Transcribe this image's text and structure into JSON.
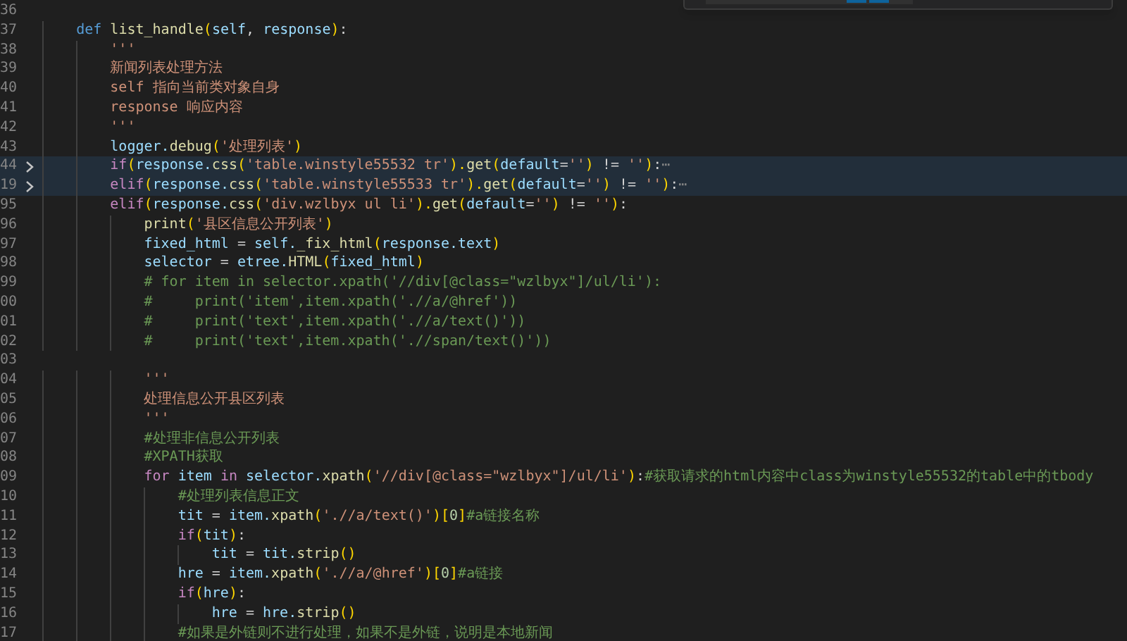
{
  "editor": {
    "lines": [
      {
        "number": "36",
        "folded": false
      },
      {
        "number": "37",
        "folded": false,
        "tokens": [
          {
            "kind": "keyword",
            "text": "    def "
          },
          {
            "kind": "function",
            "text": "list_handle"
          },
          {
            "kind": "bracket",
            "text": "("
          },
          {
            "kind": "variable",
            "text": "self"
          },
          {
            "kind": "plain",
            "text": ", "
          },
          {
            "kind": "variable",
            "text": "response"
          },
          {
            "kind": "bracket",
            "text": ")"
          },
          {
            "kind": "plain",
            "text": ":"
          }
        ]
      },
      {
        "number": "38",
        "folded": false,
        "tokens": [
          {
            "kind": "string",
            "text": "        '''"
          }
        ]
      },
      {
        "number": "39",
        "folded": false,
        "tokens": [
          {
            "kind": "string",
            "text": "        新闻列表处理方法"
          }
        ]
      },
      {
        "number": "40",
        "folded": false,
        "tokens": [
          {
            "kind": "string",
            "text": "        self 指向当前类对象自身"
          }
        ]
      },
      {
        "number": "41",
        "folded": false,
        "tokens": [
          {
            "kind": "string",
            "text": "        response 响应内容"
          }
        ]
      },
      {
        "number": "42",
        "folded": false,
        "tokens": [
          {
            "kind": "string",
            "text": "        '''"
          }
        ]
      },
      {
        "number": "43",
        "folded": false,
        "tokens": [
          {
            "kind": "variable",
            "text": "        logger."
          },
          {
            "kind": "function",
            "text": "debug"
          },
          {
            "kind": "bracket",
            "text": "("
          },
          {
            "kind": "string",
            "text": "'处理列表'"
          },
          {
            "kind": "bracket",
            "text": ")"
          }
        ]
      },
      {
        "number": "44",
        "folded": true,
        "tokens": [
          {
            "kind": "control",
            "text": "        if"
          },
          {
            "kind": "bracket",
            "text": "("
          },
          {
            "kind": "variable",
            "text": "response."
          },
          {
            "kind": "function",
            "text": "css"
          },
          {
            "kind": "bracket",
            "text": "("
          },
          {
            "kind": "string",
            "text": "'table.winstyle55532 tr'"
          },
          {
            "kind": "bracket",
            "text": ")."
          },
          {
            "kind": "function",
            "text": "get"
          },
          {
            "kind": "bracket",
            "text": "("
          },
          {
            "kind": "variable",
            "text": "default"
          },
          {
            "kind": "plain",
            "text": "="
          },
          {
            "kind": "string",
            "text": "''"
          },
          {
            "kind": "bracket",
            "text": ")"
          },
          {
            "kind": "plain",
            "text": " != "
          },
          {
            "kind": "string",
            "text": "''"
          },
          {
            "kind": "bracket",
            "text": ")"
          },
          {
            "kind": "plain",
            "text": ":"
          },
          {
            "kind": "fold",
            "text": "⋯"
          }
        ]
      },
      {
        "number": "19",
        "folded": true,
        "tokens": [
          {
            "kind": "control",
            "text": "        elif"
          },
          {
            "kind": "bracket",
            "text": "("
          },
          {
            "kind": "variable",
            "text": "response."
          },
          {
            "kind": "function",
            "text": "css"
          },
          {
            "kind": "bracket",
            "text": "("
          },
          {
            "kind": "string",
            "text": "'table.winstyle55533 tr'"
          },
          {
            "kind": "bracket",
            "text": ")."
          },
          {
            "kind": "function",
            "text": "get"
          },
          {
            "kind": "bracket",
            "text": "("
          },
          {
            "kind": "variable",
            "text": "default"
          },
          {
            "kind": "plain",
            "text": "="
          },
          {
            "kind": "string",
            "text": "''"
          },
          {
            "kind": "bracket",
            "text": ")"
          },
          {
            "kind": "plain",
            "text": " != "
          },
          {
            "kind": "string",
            "text": "''"
          },
          {
            "kind": "bracket",
            "text": ")"
          },
          {
            "kind": "plain",
            "text": ":"
          },
          {
            "kind": "fold",
            "text": "⋯"
          }
        ]
      },
      {
        "number": "95",
        "folded": false,
        "tokens": [
          {
            "kind": "control",
            "text": "        elif"
          },
          {
            "kind": "bracket",
            "text": "("
          },
          {
            "kind": "variable",
            "text": "response."
          },
          {
            "kind": "function",
            "text": "css"
          },
          {
            "kind": "bracket",
            "text": "("
          },
          {
            "kind": "string",
            "text": "'div.wzlbyx ul li'"
          },
          {
            "kind": "bracket",
            "text": ")."
          },
          {
            "kind": "function",
            "text": "get"
          },
          {
            "kind": "bracket",
            "text": "("
          },
          {
            "kind": "variable",
            "text": "default"
          },
          {
            "kind": "plain",
            "text": "="
          },
          {
            "kind": "string",
            "text": "''"
          },
          {
            "kind": "bracket",
            "text": ")"
          },
          {
            "kind": "plain",
            "text": " != "
          },
          {
            "kind": "string",
            "text": "''"
          },
          {
            "kind": "bracket",
            "text": ")"
          },
          {
            "kind": "plain",
            "text": ":"
          }
        ]
      },
      {
        "number": "96",
        "folded": false,
        "tokens": [
          {
            "kind": "function",
            "text": "            print"
          },
          {
            "kind": "bracket",
            "text": "("
          },
          {
            "kind": "string",
            "text": "'县区信息公开列表'"
          },
          {
            "kind": "bracket",
            "text": ")"
          }
        ]
      },
      {
        "number": "97",
        "folded": false,
        "tokens": [
          {
            "kind": "variable",
            "text": "            fixed_html"
          },
          {
            "kind": "plain",
            "text": " = "
          },
          {
            "kind": "variable",
            "text": "self."
          },
          {
            "kind": "function",
            "text": "_fix_html"
          },
          {
            "kind": "bracket",
            "text": "("
          },
          {
            "kind": "variable",
            "text": "response.text"
          },
          {
            "kind": "bracket",
            "text": ")"
          }
        ]
      },
      {
        "number": "98",
        "folded": false,
        "tokens": [
          {
            "kind": "variable",
            "text": "            selector"
          },
          {
            "kind": "plain",
            "text": " = "
          },
          {
            "kind": "variable",
            "text": "etree."
          },
          {
            "kind": "function",
            "text": "HTML"
          },
          {
            "kind": "bracket",
            "text": "("
          },
          {
            "kind": "variable",
            "text": "fixed_html"
          },
          {
            "kind": "bracket",
            "text": ")"
          }
        ]
      },
      {
        "number": "99",
        "folded": false,
        "tokens": [
          {
            "kind": "comment",
            "text": "            # for item in selector.xpath('//div[@class=\"wzlbyx\"]/ul/li'):"
          }
        ]
      },
      {
        "number": "00",
        "folded": false,
        "tokens": [
          {
            "kind": "comment",
            "text": "            #     print('item',item.xpath('.//a/@href'))"
          }
        ]
      },
      {
        "number": "01",
        "folded": false,
        "tokens": [
          {
            "kind": "comment",
            "text": "            #     print('text',item.xpath('.//a/text()'))"
          }
        ]
      },
      {
        "number": "02",
        "folded": false,
        "tokens": [
          {
            "kind": "comment",
            "text": "            #     print('text',item.xpath('.//span/text()'))"
          }
        ]
      },
      {
        "number": "03",
        "folded": false
      },
      {
        "number": "04",
        "folded": false,
        "tokens": [
          {
            "kind": "string",
            "text": "            '''"
          }
        ]
      },
      {
        "number": "05",
        "folded": false,
        "tokens": [
          {
            "kind": "string",
            "text": "            处理信息公开县区列表"
          }
        ]
      },
      {
        "number": "06",
        "folded": false,
        "tokens": [
          {
            "kind": "string",
            "text": "            '''"
          }
        ]
      },
      {
        "number": "07",
        "folded": false,
        "tokens": [
          {
            "kind": "comment",
            "text": "            #处理非信息公开列表"
          }
        ]
      },
      {
        "number": "08",
        "folded": false,
        "tokens": [
          {
            "kind": "comment",
            "text": "            #XPATH获取"
          }
        ]
      },
      {
        "number": "09",
        "folded": false,
        "tokens": [
          {
            "kind": "control",
            "text": "            for "
          },
          {
            "kind": "variable",
            "text": "item "
          },
          {
            "kind": "control",
            "text": "in "
          },
          {
            "kind": "variable",
            "text": "selector."
          },
          {
            "kind": "function",
            "text": "xpath"
          },
          {
            "kind": "bracket",
            "text": "("
          },
          {
            "kind": "string",
            "text": "'//div[@class=\"wzlbyx\"]/ul/li'"
          },
          {
            "kind": "bracket",
            "text": ")"
          },
          {
            "kind": "plain",
            "text": ":"
          },
          {
            "kind": "comment",
            "text": "#获取请求的html内容中class为winstyle55532的table中的tbody"
          }
        ]
      },
      {
        "number": "10",
        "folded": false,
        "tokens": [
          {
            "kind": "comment",
            "text": "                #处理列表信息正文"
          }
        ]
      },
      {
        "number": "11",
        "folded": false,
        "tokens": [
          {
            "kind": "variable",
            "text": "                tit"
          },
          {
            "kind": "plain",
            "text": " = "
          },
          {
            "kind": "variable",
            "text": "item."
          },
          {
            "kind": "function",
            "text": "xpath"
          },
          {
            "kind": "bracket",
            "text": "("
          },
          {
            "kind": "string",
            "text": "'.//a/text()'"
          },
          {
            "kind": "bracket",
            "text": ")["
          },
          {
            "kind": "number",
            "text": "0"
          },
          {
            "kind": "bracket",
            "text": "]"
          },
          {
            "kind": "comment",
            "text": "#a链接名称"
          }
        ]
      },
      {
        "number": "12",
        "folded": false,
        "tokens": [
          {
            "kind": "control",
            "text": "                if"
          },
          {
            "kind": "bracket",
            "text": "("
          },
          {
            "kind": "variable",
            "text": "tit"
          },
          {
            "kind": "bracket",
            "text": ")"
          },
          {
            "kind": "plain",
            "text": ":"
          }
        ]
      },
      {
        "number": "13",
        "folded": false,
        "tokens": [
          {
            "kind": "variable",
            "text": "                    tit"
          },
          {
            "kind": "plain",
            "text": " = "
          },
          {
            "kind": "variable",
            "text": "tit."
          },
          {
            "kind": "function",
            "text": "strip"
          },
          {
            "kind": "bracket",
            "text": "()"
          }
        ]
      },
      {
        "number": "14",
        "folded": false,
        "tokens": [
          {
            "kind": "variable",
            "text": "                hre"
          },
          {
            "kind": "plain",
            "text": " = "
          },
          {
            "kind": "variable",
            "text": "item."
          },
          {
            "kind": "function",
            "text": "xpath"
          },
          {
            "kind": "bracket",
            "text": "("
          },
          {
            "kind": "string",
            "text": "'.//a/@href'"
          },
          {
            "kind": "bracket",
            "text": ")["
          },
          {
            "kind": "number",
            "text": "0"
          },
          {
            "kind": "bracket",
            "text": "]"
          },
          {
            "kind": "comment",
            "text": "#a链接"
          }
        ]
      },
      {
        "number": "15",
        "folded": false,
        "tokens": [
          {
            "kind": "control",
            "text": "                if"
          },
          {
            "kind": "bracket",
            "text": "("
          },
          {
            "kind": "variable",
            "text": "hre"
          },
          {
            "kind": "bracket",
            "text": ")"
          },
          {
            "kind": "plain",
            "text": ":"
          }
        ]
      },
      {
        "number": "16",
        "folded": false,
        "tokens": [
          {
            "kind": "variable",
            "text": "                    hre"
          },
          {
            "kind": "plain",
            "text": " = "
          },
          {
            "kind": "variable",
            "text": "hre."
          },
          {
            "kind": "function",
            "text": "strip"
          },
          {
            "kind": "bracket",
            "text": "()"
          }
        ]
      },
      {
        "number": "17",
        "folded": false,
        "tokens": [
          {
            "kind": "comment",
            "text": "                #如果是外链则不进行处理，如果不是外链，说明是本地新闻"
          }
        ]
      }
    ]
  }
}
